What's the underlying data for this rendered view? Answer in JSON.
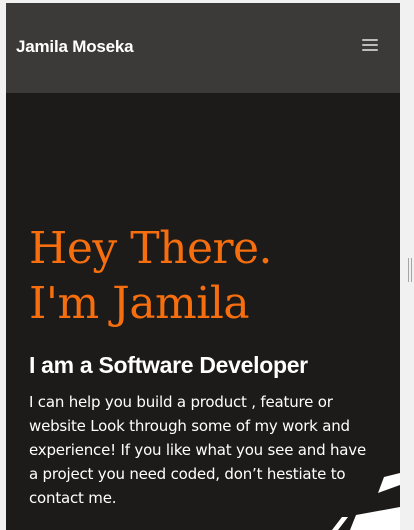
{
  "navbar": {
    "brand": "Jamila Moseka",
    "menu_icon": "hamburger-menu-icon"
  },
  "hero": {
    "heading_line1": "Hey There.",
    "heading_line2": "I'm Jamila",
    "subtitle": "I am a Software Developer",
    "description": "I can help you build a product , feature or website Look through some of my work and experience! If you like what you see and have a project you need coded, don’t hestiate to contact me."
  },
  "colors": {
    "background": "#1c1b1a",
    "navbar": "#3b3a39",
    "accent": "#f76e0f",
    "text": "#ffffff"
  }
}
